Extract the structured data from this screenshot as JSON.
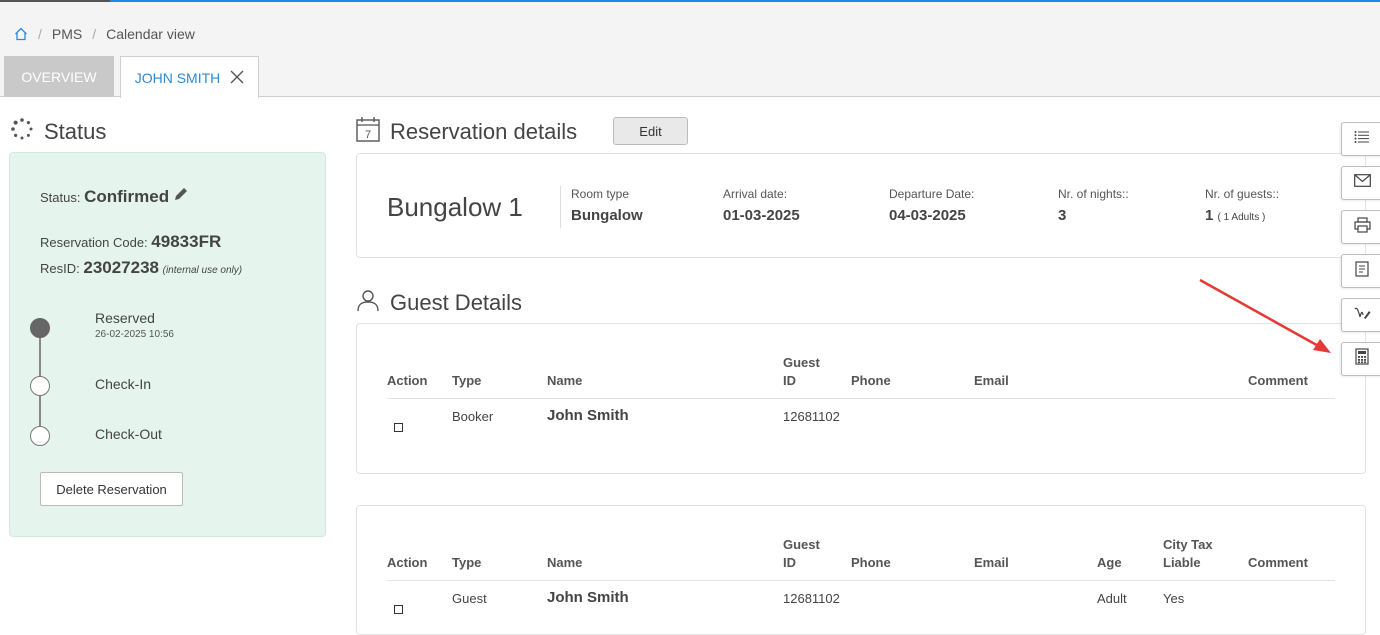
{
  "breadcrumb": {
    "home_icon": "home-icon",
    "items": [
      "PMS",
      "Calendar view"
    ]
  },
  "tabs": [
    {
      "label": "OVERVIEW",
      "active": false
    },
    {
      "label": "JOHN SMITH",
      "active": true,
      "closable": true
    }
  ],
  "status": {
    "title": "Status",
    "status_label": "Status:",
    "status_value": "Confirmed",
    "code_label": "Reservation Code:",
    "code_value": "49833FR",
    "resid_label": "ResID:",
    "resid_value": "23027238",
    "resid_note": "(internal use only)",
    "steps": [
      {
        "label": "Reserved",
        "sub": "26-02-2025 10:56",
        "done": true
      },
      {
        "label": "Check-In",
        "sub": "",
        "done": false
      },
      {
        "label": "Check-Out",
        "sub": "",
        "done": false
      }
    ],
    "delete_label": "Delete Reservation"
  },
  "reservation": {
    "title": "Reservation details",
    "edit_label": "Edit",
    "room_name": "Bungalow 1",
    "room_type_label": "Room type",
    "room_type_value": "Bungalow",
    "arrival_label": "Arrival date:",
    "arrival_value": "01-03-2025",
    "departure_label": "Departure Date:",
    "departure_value": "04-03-2025",
    "nights_label": "Nr. of nights::",
    "nights_value": "3",
    "guests_label": "Nr. of guests::",
    "guests_value": "1",
    "guests_note": "( 1 Adults )"
  },
  "guest_details": {
    "title": "Guest Details",
    "booker_table": {
      "headers": {
        "action": "Action",
        "type": "Type",
        "name": "Name",
        "guest_id": "Guest ID",
        "phone": "Phone",
        "email": "Email",
        "comment": "Comment"
      },
      "row": {
        "type": "Booker",
        "name": "John Smith",
        "guest_id": "12681102",
        "phone": "",
        "email": "",
        "comment": ""
      }
    },
    "guest_table": {
      "headers": {
        "action": "Action",
        "type": "Type",
        "name": "Name",
        "guest_id": "Guest ID",
        "phone": "Phone",
        "email": "Email",
        "age": "Age",
        "city_tax": "City Tax Liable",
        "comment": "Comment"
      },
      "row": {
        "type": "Guest",
        "name": "John Smith",
        "guest_id": "12681102",
        "phone": "",
        "email": "",
        "age": "Adult",
        "city_tax": "Yes",
        "comment": ""
      }
    }
  },
  "side_toolbar": [
    "list-icon",
    "mail-icon",
    "print-icon",
    "document-icon",
    "signature-icon",
    "calculator-icon"
  ],
  "colors": {
    "accent": "#2b8ad2",
    "status_bg": "#e5f5ee",
    "annotation_arrow": "#e53935"
  }
}
